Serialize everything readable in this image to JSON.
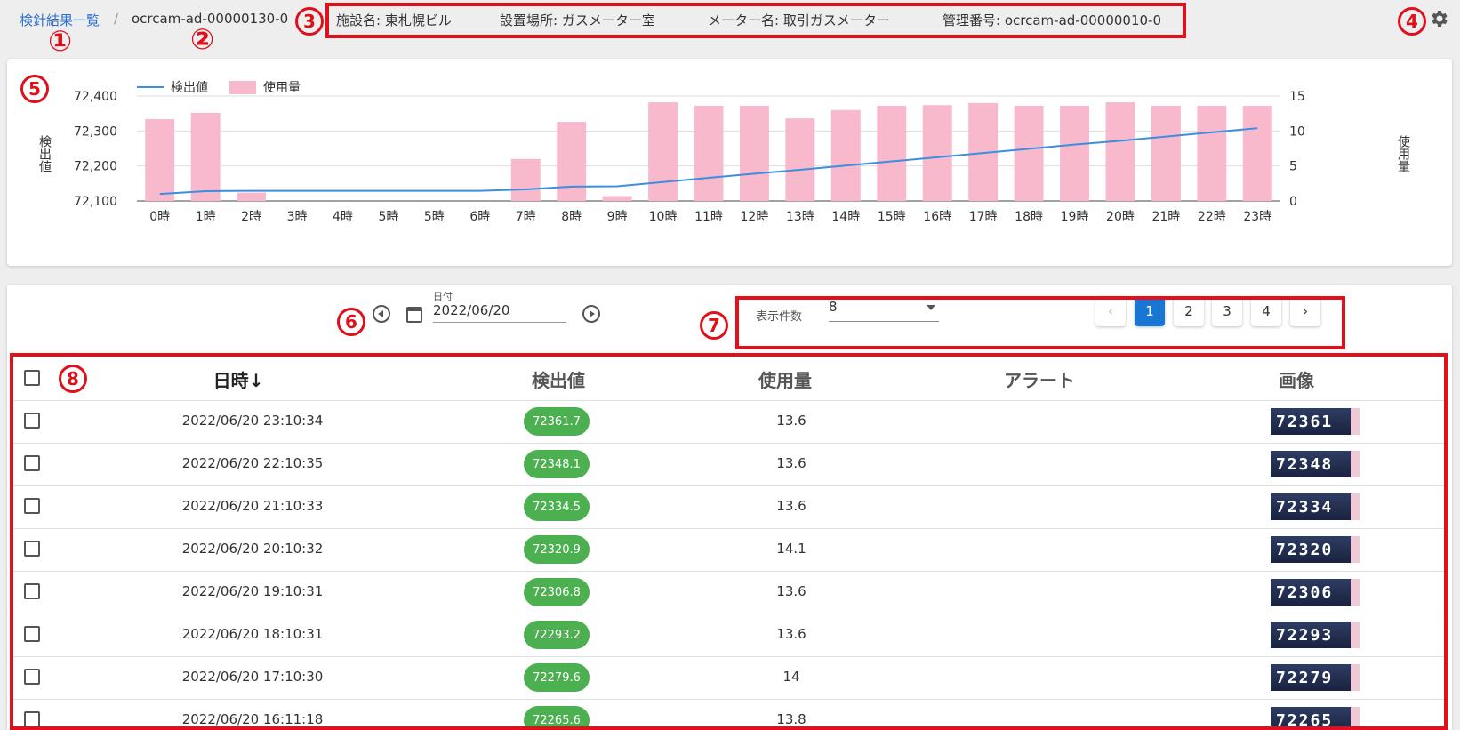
{
  "breadcrumb": {
    "link": "検針結果一覧",
    "separator": "/",
    "current": "ocrcam-ad-00000130-0"
  },
  "info": [
    {
      "label": "施設名:",
      "value": "東札幌ビル"
    },
    {
      "label": "設置場所:",
      "value": "ガスメーター室"
    },
    {
      "label": "メーター名:",
      "value": "取引ガスメーター"
    },
    {
      "label": "管理番号:",
      "value": "ocrcam-ad-00000010-0"
    }
  ],
  "callouts": [
    "①",
    "②",
    "3",
    "4",
    "5",
    "6",
    "7",
    "8"
  ],
  "icons": {
    "settings": "gear-icon",
    "prev_date": "circle-chevron-left-icon",
    "next_date": "circle-chevron-right-icon",
    "calendar": "calendar-icon"
  },
  "colors": {
    "accent": "#1976d2",
    "link": "#2a6fd1",
    "badge": "#4caf50",
    "bar": "#f8b9cd",
    "line": "#3b8fe0",
    "callout": "#e3101c"
  },
  "chart_data": {
    "type": "bar",
    "categories": [
      "0時",
      "1時",
      "2時",
      "3時",
      "4時",
      "5時",
      "5時",
      "6時",
      "7時",
      "8時",
      "9時",
      "10時",
      "11時",
      "12時",
      "13時",
      "14時",
      "15時",
      "16時",
      "17時",
      "18時",
      "19時",
      "20時",
      "21時",
      "22時",
      "23時"
    ],
    "series": [
      {
        "name": "検出値",
        "type": "line",
        "axis": "left",
        "values": [
          72120,
          72128,
          72129,
          72129,
          72129,
          72129,
          72129,
          72129,
          72133,
          72141,
          72142,
          72154,
          72166,
          72178,
          72189,
          72201,
          72213,
          72225,
          72237,
          72249,
          72261,
          72272,
          72284,
          72296,
          72308
        ]
      },
      {
        "name": "使用量",
        "type": "bar",
        "axis": "right",
        "values": [
          11.7,
          12.6,
          1.2,
          0,
          0,
          0,
          0,
          0,
          6,
          11.3,
          0.7,
          14.1,
          13.6,
          13.6,
          11.8,
          13,
          13.6,
          13.7,
          14,
          13.6,
          13.6,
          14.1,
          13.6,
          13.6,
          13.6
        ]
      }
    ],
    "left_axis": {
      "label": "検出値",
      "ticks": [
        "72,400",
        "72,300",
        "72,200",
        "72,100"
      ],
      "range": [
        72100,
        72400
      ]
    },
    "right_axis": {
      "label": "使用量",
      "ticks": [
        "15",
        "10",
        "5",
        "0"
      ],
      "range": [
        0,
        15
      ]
    },
    "legend_position": "top-left",
    "grid": true
  },
  "controls": {
    "date_label": "日付",
    "date_value": "2022/06/20",
    "per_page_label": "表示件数",
    "per_page_value": "8",
    "pages": [
      "1",
      "2",
      "3",
      "4"
    ],
    "current_page": "1",
    "prev": "‹",
    "next": "›"
  },
  "table": {
    "headers": {
      "datetime": "日時↓",
      "reading": "検出値",
      "usage": "使用量",
      "alert": "アラート",
      "image": "画像"
    },
    "rows": [
      {
        "datetime": "2022/06/20 23:10:34",
        "reading": "72361.7",
        "usage": "13.6",
        "alert": "",
        "image_digits": "72361"
      },
      {
        "datetime": "2022/06/20 22:10:35",
        "reading": "72348.1",
        "usage": "13.6",
        "alert": "",
        "image_digits": "72348"
      },
      {
        "datetime": "2022/06/20 21:10:33",
        "reading": "72334.5",
        "usage": "13.6",
        "alert": "",
        "image_digits": "72334"
      },
      {
        "datetime": "2022/06/20 20:10:32",
        "reading": "72320.9",
        "usage": "14.1",
        "alert": "",
        "image_digits": "72320"
      },
      {
        "datetime": "2022/06/20 19:10:31",
        "reading": "72306.8",
        "usage": "13.6",
        "alert": "",
        "image_digits": "72306"
      },
      {
        "datetime": "2022/06/20 18:10:31",
        "reading": "72293.2",
        "usage": "13.6",
        "alert": "",
        "image_digits": "72293"
      },
      {
        "datetime": "2022/06/20 17:10:30",
        "reading": "72279.6",
        "usage": "14",
        "alert": "",
        "image_digits": "72279"
      },
      {
        "datetime": "2022/06/20 16:11:18",
        "reading": "72265.6",
        "usage": "13.8",
        "alert": "",
        "image_digits": "72265"
      }
    ]
  }
}
